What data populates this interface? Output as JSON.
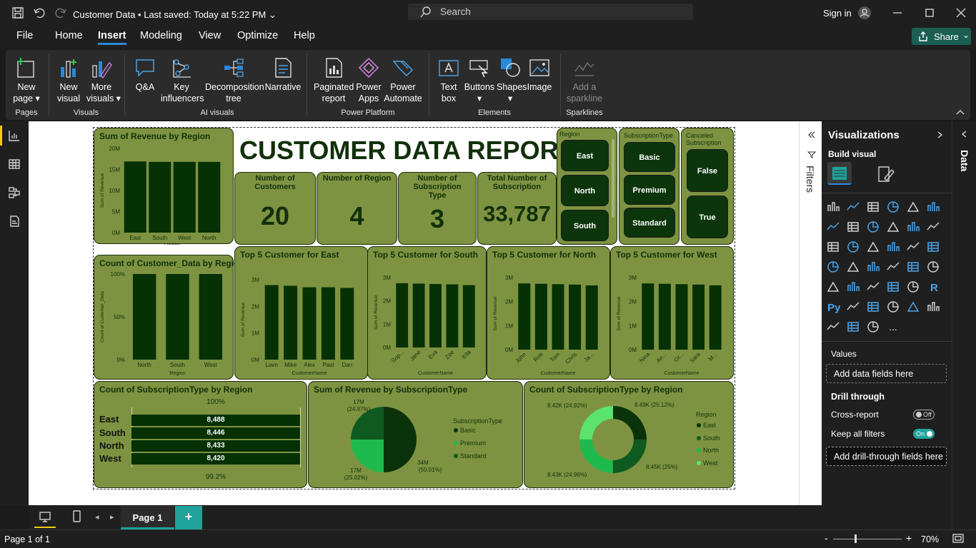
{
  "titlebar": {
    "title": "Customer Data",
    "saved": "• Last saved: Today at 5:22 PM",
    "search_placeholder": "Search",
    "signin": "Sign in"
  },
  "menu": {
    "file": "File",
    "home": "Home",
    "insert": "Insert",
    "modeling": "Modeling",
    "view": "View",
    "optimize": "Optimize",
    "help": "Help",
    "share": "Share"
  },
  "ribbon": {
    "new_page": [
      "New",
      "page ▾"
    ],
    "new_visual": [
      "New",
      "visual"
    ],
    "more_visuals": [
      "More",
      "visuals ▾"
    ],
    "qa": "Q&A",
    "key_influencers": [
      "Key",
      "influencers"
    ],
    "decomp": [
      "Decomposition",
      "tree"
    ],
    "narrative": "Narrative",
    "paginated": [
      "Paginated",
      "report"
    ],
    "power_apps": [
      "Power",
      "Apps"
    ],
    "power_automate": [
      "Power",
      "Automate"
    ],
    "text_box": [
      "Text",
      "box"
    ],
    "buttons": [
      "Buttons",
      "▾"
    ],
    "shapes": [
      "Shapes",
      "▾"
    ],
    "image": "Image",
    "sparkline": [
      "Add a",
      "sparkline"
    ],
    "groups": {
      "pages": "Pages",
      "visuals": "Visuals",
      "ai": "AI visuals",
      "power": "Power Platform",
      "elements": "Elements",
      "sparklines": "Sparklines"
    }
  },
  "report": {
    "title": "CUSTOMER DATA REPORT",
    "kpis": [
      {
        "label": "Number of Customers",
        "value": "20"
      },
      {
        "label": "Number of Region",
        "value": "4"
      },
      {
        "label": "Number of Subscription Type",
        "value": "3"
      },
      {
        "label": "Total Number of Subscription",
        "value": "33,787"
      }
    ],
    "slicers": {
      "region": {
        "title": "Region",
        "items": [
          "East",
          "North",
          "South"
        ]
      },
      "subscription": {
        "title": "SubscriptionType",
        "items": [
          "Basic",
          "Premium",
          "Standard"
        ]
      },
      "canceled": {
        "title": "Canceled Subscription",
        "items": [
          "False",
          "True"
        ]
      }
    },
    "hbars": {
      "title": "Count of SubscriptionType by Region",
      "top_label": "100%",
      "bottom_label": "99.2%",
      "rows": [
        {
          "cat": "East",
          "val": "8,488"
        },
        {
          "cat": "South",
          "val": "8,446"
        },
        {
          "cat": "North",
          "val": "8,433"
        },
        {
          "cat": "West",
          "val": "8,420"
        }
      ]
    },
    "pie": {
      "title": "Sum of Revenue by SubscriptionType",
      "legend_title": "SubscriptionType",
      "legend": [
        "Basic",
        "Premium",
        "Standard"
      ],
      "labels": [
        {
          "v": "17M",
          "p": "(24.97%)"
        },
        {
          "v": "34M",
          "p": "(50.01%)"
        },
        {
          "v": "17M",
          "p": "(25.02%)"
        }
      ]
    },
    "donut": {
      "title": "Count of SubscriptionType by Region",
      "legend_title": "Region",
      "legend": [
        "East",
        "South",
        "North",
        "West"
      ],
      "labels": [
        "8.49K (25.12%)",
        "8.45K (25%)",
        "8.43K (24.96%)",
        "8.42K (24.92%)"
      ]
    }
  },
  "chart_data": [
    {
      "type": "bar",
      "title": "Sum of Revenue by Region",
      "categories": [
        "East",
        "South",
        "West",
        "North"
      ],
      "values": [
        16.9,
        16.8,
        16.8,
        16.8
      ],
      "xlabel": "Region",
      "ylabel": "Sum of Revenue",
      "yticks": [
        "0M",
        "5M",
        "10M",
        "15M",
        "20M"
      ],
      "ylim": [
        0,
        20
      ]
    },
    {
      "type": "bar",
      "title": "Count of Customer_Data by Region",
      "categories": [
        "North",
        "South",
        "West"
      ],
      "values": [
        100,
        100,
        100
      ],
      "xlabel": "Region",
      "ylabel": "Count of Customer_Data",
      "yticks": [
        "0%",
        "50%",
        "100%"
      ],
      "ylim": [
        0,
        100
      ]
    },
    {
      "type": "bar",
      "title": "Top 5 Customer for East",
      "categories": [
        "Liam",
        "Mike",
        "Alex",
        "Paul",
        "Dan"
      ],
      "values": [
        3.45,
        3.42,
        3.35,
        3.35,
        3.32
      ],
      "xlabel": "CustomerName",
      "ylabel": "Sum of Revenue",
      "yticks": [
        "0M",
        "1M",
        "2M",
        "3M"
      ],
      "ylim": [
        0,
        3.7
      ]
    },
    {
      "type": "bar",
      "title": "Top 5 Customer for South",
      "categories": [
        "Sop...",
        "Jane",
        "Eva",
        "Zoe",
        "Ella"
      ],
      "values": [
        3.4,
        3.38,
        3.36,
        3.34,
        3.3
      ],
      "xlabel": "CustomerName",
      "ylabel": "Sum of Revenue",
      "yticks": [
        "0M",
        "1M",
        "2M",
        "3M"
      ],
      "ylim": [
        0,
        3.7
      ]
    },
    {
      "type": "bar",
      "title": "Top 5 Customer for North",
      "categories": [
        "John",
        "Rob",
        "Tom",
        "Chris",
        "Ja..."
      ],
      "values": [
        3.4,
        3.38,
        3.36,
        3.34,
        3.3
      ],
      "xlabel": "CustomerName",
      "ylabel": "Sum of Revenue",
      "yticks": [
        "0M",
        "1M",
        "2M",
        "3M"
      ],
      "ylim": [
        0,
        3.7
      ]
    },
    {
      "type": "bar",
      "title": "Top 5 Customer for West",
      "categories": [
        "Nina",
        "An...",
        "Gr...",
        "Sara",
        "M..."
      ],
      "values": [
        3.4,
        3.38,
        3.36,
        3.34,
        3.3
      ],
      "xlabel": "CustomerName",
      "ylabel": "Sum of Revenue",
      "yticks": [
        "0M",
        "1M",
        "2M",
        "3M"
      ],
      "ylim": [
        0,
        3.7
      ]
    },
    {
      "type": "bar",
      "title": "Count of SubscriptionType by Region",
      "categories": [
        "East",
        "South",
        "North",
        "West"
      ],
      "values": [
        8488,
        8446,
        8433,
        8420
      ]
    },
    {
      "type": "pie",
      "title": "Sum of Revenue by SubscriptionType",
      "categories": [
        "Basic",
        "Premium",
        "Standard"
      ],
      "values": [
        50.01,
        25.02,
        24.97
      ]
    },
    {
      "type": "pie",
      "title": "Count of SubscriptionType by Region",
      "categories": [
        "East",
        "South",
        "North",
        "West"
      ],
      "values": [
        25.12,
        25.0,
        24.96,
        24.92
      ]
    }
  ],
  "viz": {
    "title": "Visualizations",
    "build": "Build visual",
    "values": "Values",
    "values_well": "Add data fields here",
    "drill": "Drill through",
    "cross": "Cross-report",
    "cross_state": "Off",
    "keep": "Keep all filters",
    "keep_state": "On",
    "drill_well": "Add drill-through fields here",
    "more": "...",
    "py": "Py",
    "r": "R"
  },
  "filters": "Filters",
  "data_tab": "Data",
  "page_tab": "Page 1",
  "status": {
    "page": "Page 1 of 1",
    "zoom": "70%"
  },
  "colors": {
    "card": "#7e9341",
    "bar": "#053105",
    "dark_green": "#0a330a",
    "mid_green": "#1d8a34",
    "light_green": "#22c85a",
    "pale_green": "#5be36f"
  }
}
